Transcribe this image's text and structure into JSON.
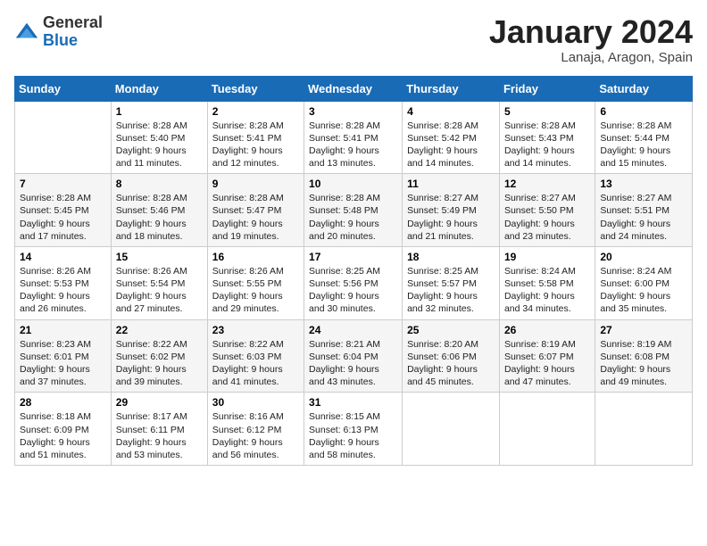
{
  "header": {
    "logo_general": "General",
    "logo_blue": "Blue",
    "month_title": "January 2024",
    "subtitle": "Lanaja, Aragon, Spain"
  },
  "days_of_week": [
    "Sunday",
    "Monday",
    "Tuesday",
    "Wednesday",
    "Thursday",
    "Friday",
    "Saturday"
  ],
  "weeks": [
    [
      {
        "day": "",
        "info": ""
      },
      {
        "day": "1",
        "info": "Sunrise: 8:28 AM\nSunset: 5:40 PM\nDaylight: 9 hours and 11 minutes."
      },
      {
        "day": "2",
        "info": "Sunrise: 8:28 AM\nSunset: 5:41 PM\nDaylight: 9 hours and 12 minutes."
      },
      {
        "day": "3",
        "info": "Sunrise: 8:28 AM\nSunset: 5:41 PM\nDaylight: 9 hours and 13 minutes."
      },
      {
        "day": "4",
        "info": "Sunrise: 8:28 AM\nSunset: 5:42 PM\nDaylight: 9 hours and 14 minutes."
      },
      {
        "day": "5",
        "info": "Sunrise: 8:28 AM\nSunset: 5:43 PM\nDaylight: 9 hours and 14 minutes."
      },
      {
        "day": "6",
        "info": "Sunrise: 8:28 AM\nSunset: 5:44 PM\nDaylight: 9 hours and 15 minutes."
      }
    ],
    [
      {
        "day": "7",
        "info": "Sunrise: 8:28 AM\nSunset: 5:45 PM\nDaylight: 9 hours and 17 minutes."
      },
      {
        "day": "8",
        "info": "Sunrise: 8:28 AM\nSunset: 5:46 PM\nDaylight: 9 hours and 18 minutes."
      },
      {
        "day": "9",
        "info": "Sunrise: 8:28 AM\nSunset: 5:47 PM\nDaylight: 9 hours and 19 minutes."
      },
      {
        "day": "10",
        "info": "Sunrise: 8:28 AM\nSunset: 5:48 PM\nDaylight: 9 hours and 20 minutes."
      },
      {
        "day": "11",
        "info": "Sunrise: 8:27 AM\nSunset: 5:49 PM\nDaylight: 9 hours and 21 minutes."
      },
      {
        "day": "12",
        "info": "Sunrise: 8:27 AM\nSunset: 5:50 PM\nDaylight: 9 hours and 23 minutes."
      },
      {
        "day": "13",
        "info": "Sunrise: 8:27 AM\nSunset: 5:51 PM\nDaylight: 9 hours and 24 minutes."
      }
    ],
    [
      {
        "day": "14",
        "info": "Sunrise: 8:26 AM\nSunset: 5:53 PM\nDaylight: 9 hours and 26 minutes."
      },
      {
        "day": "15",
        "info": "Sunrise: 8:26 AM\nSunset: 5:54 PM\nDaylight: 9 hours and 27 minutes."
      },
      {
        "day": "16",
        "info": "Sunrise: 8:26 AM\nSunset: 5:55 PM\nDaylight: 9 hours and 29 minutes."
      },
      {
        "day": "17",
        "info": "Sunrise: 8:25 AM\nSunset: 5:56 PM\nDaylight: 9 hours and 30 minutes."
      },
      {
        "day": "18",
        "info": "Sunrise: 8:25 AM\nSunset: 5:57 PM\nDaylight: 9 hours and 32 minutes."
      },
      {
        "day": "19",
        "info": "Sunrise: 8:24 AM\nSunset: 5:58 PM\nDaylight: 9 hours and 34 minutes."
      },
      {
        "day": "20",
        "info": "Sunrise: 8:24 AM\nSunset: 6:00 PM\nDaylight: 9 hours and 35 minutes."
      }
    ],
    [
      {
        "day": "21",
        "info": "Sunrise: 8:23 AM\nSunset: 6:01 PM\nDaylight: 9 hours and 37 minutes."
      },
      {
        "day": "22",
        "info": "Sunrise: 8:22 AM\nSunset: 6:02 PM\nDaylight: 9 hours and 39 minutes."
      },
      {
        "day": "23",
        "info": "Sunrise: 8:22 AM\nSunset: 6:03 PM\nDaylight: 9 hours and 41 minutes."
      },
      {
        "day": "24",
        "info": "Sunrise: 8:21 AM\nSunset: 6:04 PM\nDaylight: 9 hours and 43 minutes."
      },
      {
        "day": "25",
        "info": "Sunrise: 8:20 AM\nSunset: 6:06 PM\nDaylight: 9 hours and 45 minutes."
      },
      {
        "day": "26",
        "info": "Sunrise: 8:19 AM\nSunset: 6:07 PM\nDaylight: 9 hours and 47 minutes."
      },
      {
        "day": "27",
        "info": "Sunrise: 8:19 AM\nSunset: 6:08 PM\nDaylight: 9 hours and 49 minutes."
      }
    ],
    [
      {
        "day": "28",
        "info": "Sunrise: 8:18 AM\nSunset: 6:09 PM\nDaylight: 9 hours and 51 minutes."
      },
      {
        "day": "29",
        "info": "Sunrise: 8:17 AM\nSunset: 6:11 PM\nDaylight: 9 hours and 53 minutes."
      },
      {
        "day": "30",
        "info": "Sunrise: 8:16 AM\nSunset: 6:12 PM\nDaylight: 9 hours and 56 minutes."
      },
      {
        "day": "31",
        "info": "Sunrise: 8:15 AM\nSunset: 6:13 PM\nDaylight: 9 hours and 58 minutes."
      },
      {
        "day": "",
        "info": ""
      },
      {
        "day": "",
        "info": ""
      },
      {
        "day": "",
        "info": ""
      }
    ]
  ]
}
